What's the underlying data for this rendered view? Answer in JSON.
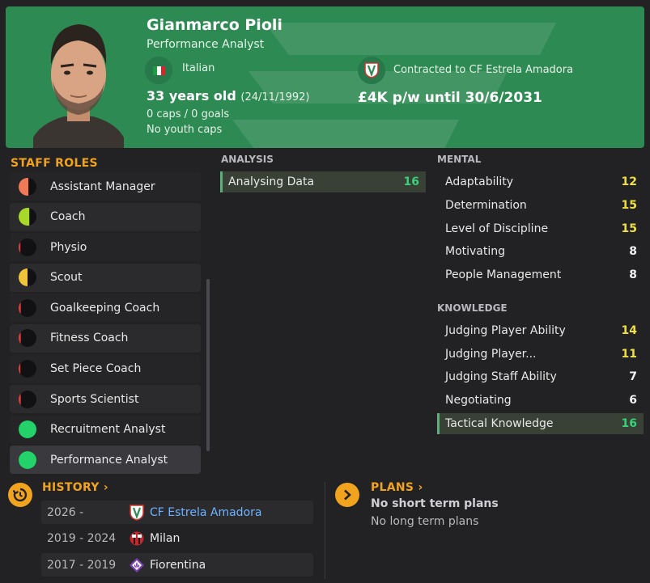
{
  "header": {
    "name": "Gianmarco Pioli",
    "role": "Performance Analyst",
    "nationality": "Italian",
    "age": "33 years old",
    "dob": "(24/11/1992)",
    "caps": "0 caps / 0 goals",
    "youth_caps": "No youth caps",
    "contract": "Contracted to CF Estrela Amadora",
    "wage": "£4K p/w until 30/6/2031",
    "colors": {
      "background": "#2e8a53",
      "flag": [
        "#1f9b46",
        "#ffffff",
        "#d6262b"
      ]
    }
  },
  "staff_roles": {
    "title": "STAFF ROLES",
    "items": [
      {
        "label": "Assistant Manager",
        "icon": "half-circle-orange-red-icon",
        "color": "#f07a56",
        "fill": 0.55
      },
      {
        "label": "Coach",
        "icon": "half-circle-yellow-green-icon",
        "color": "#a8d82a",
        "fill": 0.6
      },
      {
        "label": "Physio",
        "icon": "sliver-red-icon",
        "color": "#e04040",
        "fill": 0.1
      },
      {
        "label": "Scout",
        "icon": "half-circle-yellow-icon",
        "color": "#f0c43a",
        "fill": 0.5
      },
      {
        "label": "Goalkeeping Coach",
        "icon": "sliver-red-icon",
        "color": "#e04040",
        "fill": 0.12
      },
      {
        "label": "Fitness Coach",
        "icon": "sliver-red-icon",
        "color": "#e04040",
        "fill": 0.12
      },
      {
        "label": "Set Piece Coach",
        "icon": "sliver-red-icon",
        "color": "#e04040",
        "fill": 0.1
      },
      {
        "label": "Sports Scientist",
        "icon": "sliver-red-icon",
        "color": "#e04040",
        "fill": 0.12
      },
      {
        "label": "Recruitment Analyst",
        "icon": "full-circle-green-icon",
        "color": "#23d36a",
        "fill": 1
      },
      {
        "label": "Performance Analyst",
        "icon": "full-circle-green-icon",
        "color": "#23d36a",
        "fill": 1
      }
    ]
  },
  "analysis": {
    "title": "ANALYSIS",
    "attributes": [
      {
        "label": "Analysing Data",
        "value": "16"
      }
    ]
  },
  "mental": {
    "title": "MENTAL",
    "attributes": [
      {
        "label": "Adaptability",
        "value": "12"
      },
      {
        "label": "Determination",
        "value": "15"
      },
      {
        "label": "Level of Discipline",
        "value": "15"
      },
      {
        "label": "Motivating",
        "value": "8"
      },
      {
        "label": "People Management",
        "value": "8"
      }
    ]
  },
  "knowledge": {
    "title": "KNOWLEDGE",
    "attributes": [
      {
        "label": "Judging Player Ability",
        "value": "14"
      },
      {
        "label": "Judging Player...",
        "value": "11"
      },
      {
        "label": "Judging Staff Ability",
        "value": "7"
      },
      {
        "label": "Negotiating",
        "value": "6"
      },
      {
        "label": "Tactical Knowledge",
        "value": "16"
      }
    ]
  },
  "history": {
    "title": "HISTORY",
    "rows": [
      {
        "years": "2026 -",
        "club": "CF Estrela Amadora"
      },
      {
        "years": "2019 - 2024",
        "club": "Milan"
      },
      {
        "years": "2017 - 2019",
        "club": "Fiorentina"
      }
    ]
  },
  "plans": {
    "title": "PLANS",
    "short": "No short term plans",
    "long": "No long term plans"
  }
}
